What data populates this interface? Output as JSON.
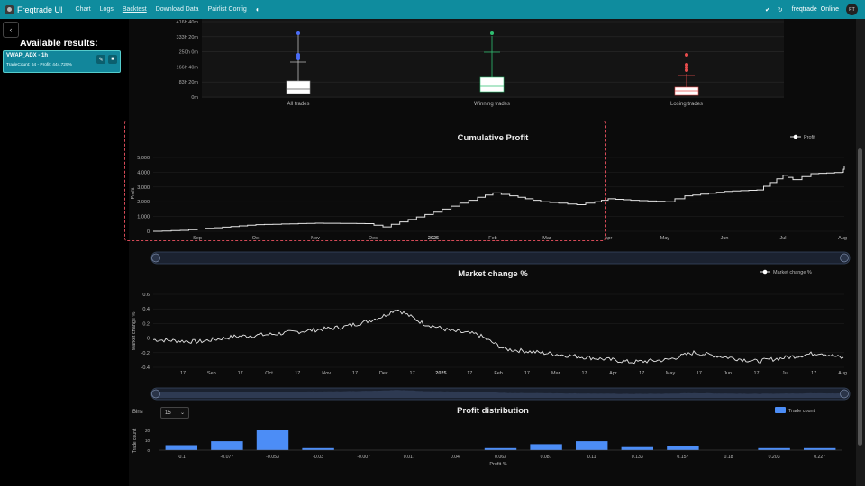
{
  "navbar": {
    "brand": "Freqtrade UI",
    "links": [
      "Chart",
      "Logs",
      "Backtest",
      "Download Data",
      "Pairlist Config"
    ],
    "active": "Backtest",
    "bot_name": "freqtrade",
    "bot_status": "Online",
    "avatar": "FT",
    "icons": [
      "theme-icon",
      "pin-icon",
      "refresh-icon"
    ]
  },
  "sidebar": {
    "back_icon": "‹",
    "title": "Available results:",
    "result": {
      "name": "VWAP_ADX - 1h",
      "summary": "TradeCount: 64 - Profit: 444.729%"
    }
  },
  "colors": {
    "accent": "#0f8c9e",
    "win": "#2fbf71",
    "loss": "#e74c4c",
    "all": "#4a6cf7",
    "bar": "#4c8df6"
  },
  "boxplot": {
    "y_ticks": [
      "0m",
      "83h 20m",
      "166h 40m",
      "250h 0m",
      "333h 20m",
      "416h 40m"
    ],
    "categories": [
      "All trades",
      "Winning trades",
      "Losing trades"
    ]
  },
  "cumulative_profit": {
    "title": "Cumulative Profit",
    "legend": "Profit",
    "ylabel": "Profit",
    "y_ticks": [
      "0",
      "1,000",
      "2,000",
      "3,000",
      "4,000",
      "5,000"
    ],
    "x_ticks": [
      "Sep",
      "Oct",
      "Nov",
      "Dec",
      "2025",
      "Feb",
      "Mar",
      "Apr",
      "May",
      "Jun",
      "Jul",
      "Aug"
    ]
  },
  "market_change": {
    "title": "Market change %",
    "legend": "Market change %",
    "ylabel": "Market change %",
    "y_ticks": [
      "0.6",
      "0.4",
      "0.2",
      "0",
      "-0.2",
      "-0.4"
    ],
    "x_ticks": [
      "17",
      "Sep",
      "17",
      "Oct",
      "17",
      "Nov",
      "17",
      "Dec",
      "17",
      "2025",
      "17",
      "Feb",
      "17",
      "Mar",
      "17",
      "Apr",
      "17",
      "May",
      "17",
      "Jun",
      "17",
      "Jul",
      "17",
      "Aug"
    ]
  },
  "profit_distribution": {
    "title": "Profit distribution",
    "bins_label": "Bins",
    "bins_value": "15",
    "legend": "Trade count",
    "xlabel": "Profit %",
    "ylabel": "Trade count",
    "y_ticks": [
      "0",
      "10",
      "20"
    ]
  },
  "chart_data": [
    {
      "type": "line",
      "title": "Cumulative Profit",
      "ylabel": "Profit",
      "ylim": [
        0,
        5000
      ],
      "x": [
        "Sep",
        "Oct",
        "Nov",
        "Dec",
        "2025",
        "Feb",
        "Mar",
        "Apr",
        "May",
        "Jun",
        "Jul",
        "Aug"
      ],
      "series": [
        {
          "name": "Profit",
          "values": [
            150,
            450,
            550,
            300,
            1300,
            2600,
            1800,
            2200,
            2000,
            2800,
            3800,
            4400
          ]
        }
      ]
    },
    {
      "type": "line",
      "title": "Market change %",
      "ylabel": "Market change %",
      "ylim": [
        -0.4,
        0.6
      ],
      "x": [
        "Sep",
        "Oct",
        "Nov",
        "Dec",
        "2025",
        "Feb",
        "Mar",
        "Apr",
        "May",
        "Jun",
        "Jul",
        "Aug"
      ],
      "series": [
        {
          "name": "Market change %",
          "values": [
            -0.02,
            0.04,
            0.1,
            0.35,
            0.1,
            -0.1,
            -0.2,
            -0.3,
            -0.25,
            -0.22,
            -0.25,
            -0.25
          ]
        }
      ]
    },
    {
      "type": "bar",
      "title": "Profit distribution",
      "xlabel": "Profit %",
      "ylabel": "Trade count",
      "categories": [
        "-0.1",
        "-0.077",
        "-0.053",
        "-0.03",
        "-0.007",
        "0.017",
        "0.04",
        "0.063",
        "0.087",
        "0.11",
        "0.133",
        "0.157",
        "0.18",
        "0.203",
        "0.227"
      ],
      "values": [
        5,
        9,
        20,
        2,
        0,
        0,
        0,
        2,
        6,
        9,
        3,
        4,
        0,
        2,
        2
      ],
      "ylim": [
        0,
        20
      ]
    }
  ]
}
